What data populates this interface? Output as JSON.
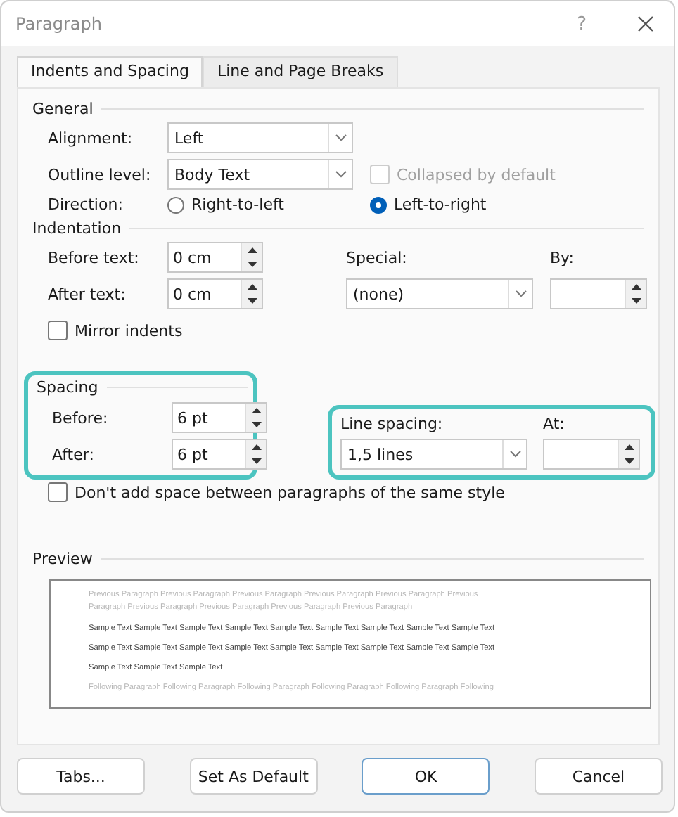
{
  "window": {
    "title": "Paragraph",
    "help": "?"
  },
  "tabs": [
    {
      "label": "Indents and Spacing",
      "selected": true
    },
    {
      "label": "Line and Page Breaks",
      "selected": false
    }
  ],
  "general": {
    "heading": "General",
    "alignment": {
      "label": "Alignment:",
      "value": "Left"
    },
    "outline_level": {
      "label": "Outline level:",
      "value": "Body Text"
    },
    "collapsed": {
      "label": "Collapsed by default",
      "checked": false,
      "disabled": true
    },
    "direction": {
      "label": "Direction:",
      "options": [
        {
          "label": "Right-to-left",
          "selected": false
        },
        {
          "label": "Left-to-right",
          "selected": true
        }
      ]
    }
  },
  "indentation": {
    "heading": "Indentation",
    "before_text": {
      "label": "Before text:",
      "value": "0 cm"
    },
    "after_text": {
      "label": "After text:",
      "value": "0 cm"
    },
    "special": {
      "label": "Special:",
      "value": "(none)"
    },
    "by": {
      "label": "By:"
    },
    "mirror": {
      "label": "Mirror indents",
      "checked": false
    }
  },
  "spacing": {
    "heading": "Spacing",
    "highlighted": true,
    "before": {
      "label": "Before:",
      "value": "6 pt"
    },
    "after": {
      "label": "After:",
      "value": "6 pt"
    }
  },
  "line_spacing": {
    "highlighted": true,
    "label": "Line spacing:",
    "value": "1,5 lines",
    "at": {
      "label": "At:"
    }
  },
  "dont_add": {
    "label": "Don't add space between paragraphs of the same style",
    "checked": false
  },
  "preview": {
    "heading": "Preview",
    "previous_lines": [
      "Previous Paragraph Previous Paragraph Previous Paragraph Previous Paragraph Previous Paragraph Previous",
      "Paragraph Previous Paragraph Previous Paragraph Previous Paragraph Previous Paragraph"
    ],
    "sample_lines": [
      "Sample Text Sample Text Sample Text Sample Text Sample Text Sample Text Sample Text Sample Text Sample Text",
      "Sample Text Sample Text Sample Text Sample Text Sample Text Sample Text Sample Text Sample Text Sample Text",
      "Sample Text Sample Text Sample Text"
    ],
    "following_lines": [
      "Following Paragraph Following Paragraph Following Paragraph Following Paragraph Following Paragraph Following"
    ]
  },
  "buttons": [
    {
      "label": "Tabs...",
      "default": false
    },
    {
      "label": "Set As Default",
      "default": false
    },
    {
      "label": "OK",
      "default": true
    },
    {
      "label": "Cancel",
      "default": false
    }
  ]
}
